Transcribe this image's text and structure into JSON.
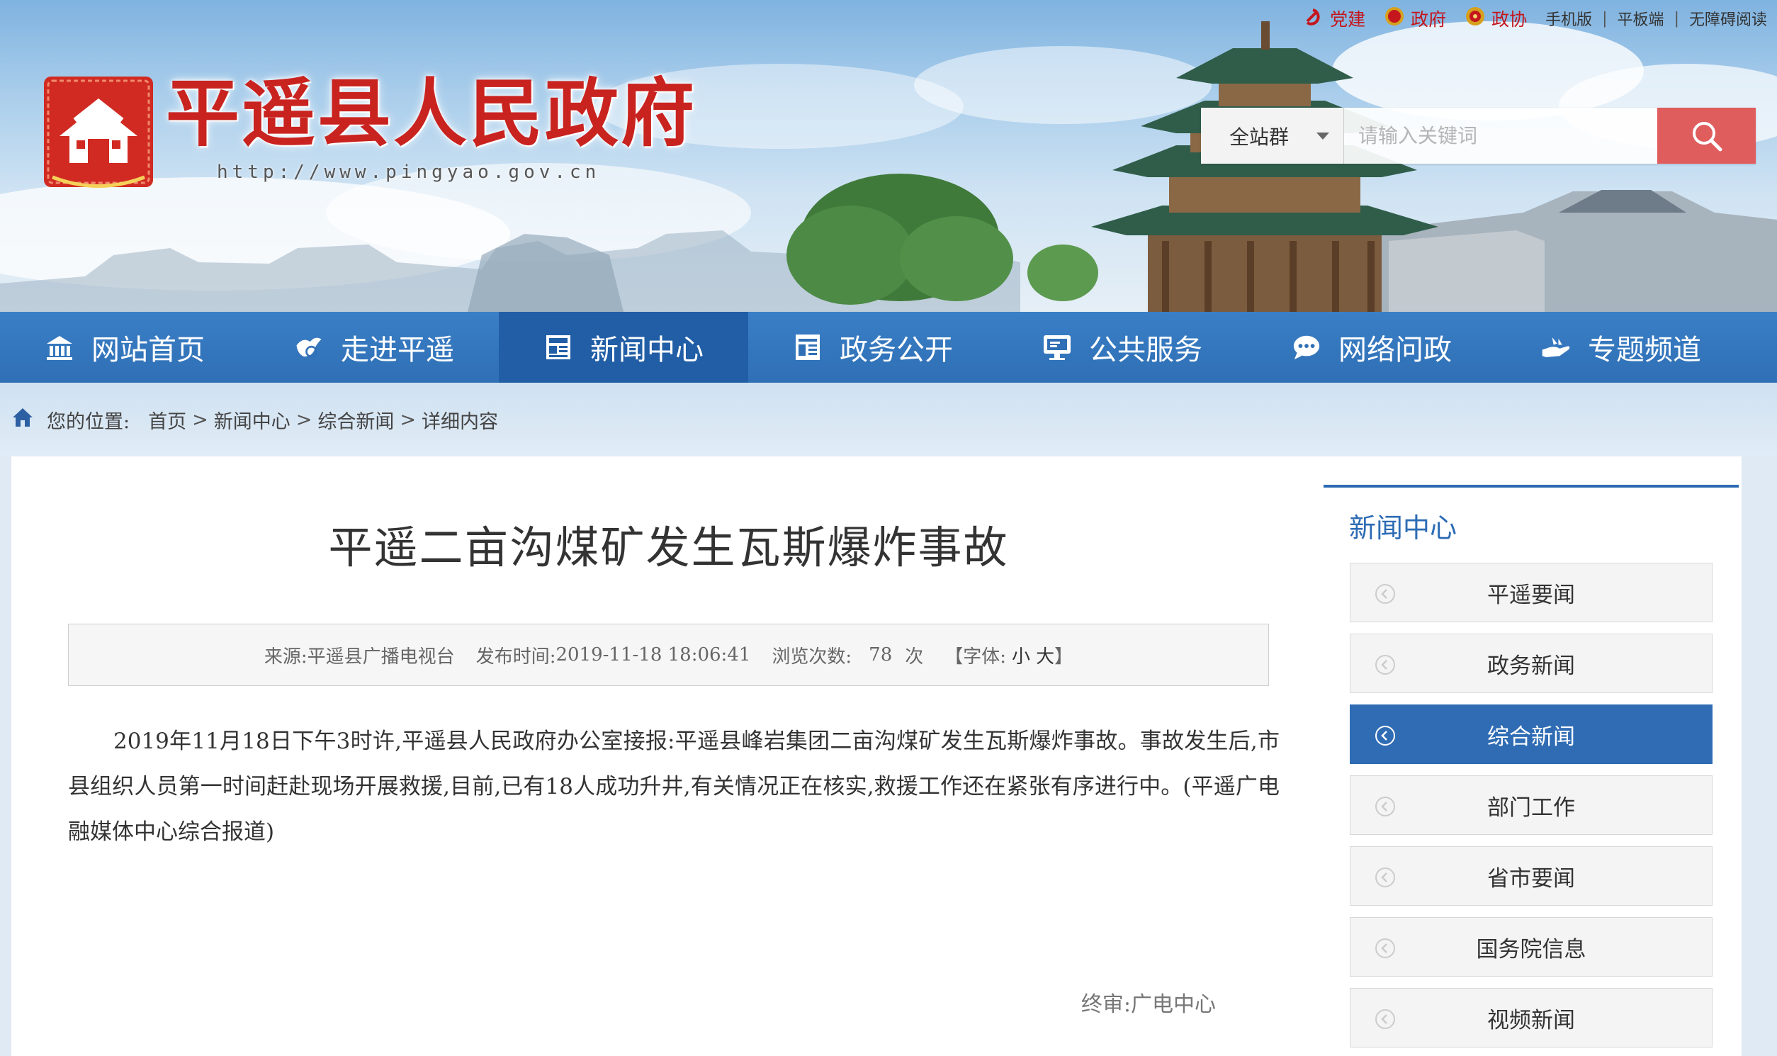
{
  "topbar": {
    "party_links": [
      "党建",
      "政府",
      "政协"
    ],
    "links": [
      "手机版",
      "平板端",
      "无障碍阅读"
    ],
    "separator": "|"
  },
  "header": {
    "site_title": "平遥县人民政府",
    "site_url": "http://www.pingyao.gov.cn"
  },
  "search": {
    "scope_label": "全站群",
    "placeholder": "请输入关键词"
  },
  "nav": {
    "items": [
      {
        "label": "网站首页",
        "icon": "bank-icon"
      },
      {
        "label": "走进平遥",
        "icon": "bird-icon"
      },
      {
        "label": "新闻中心",
        "icon": "newspaper-icon"
      },
      {
        "label": "政务公开",
        "icon": "document-icon"
      },
      {
        "label": "公共服务",
        "icon": "monitor-icon"
      },
      {
        "label": "网络问政",
        "icon": "chat-icon"
      },
      {
        "label": "专题频道",
        "icon": "hand-icon"
      }
    ],
    "active_index": 2
  },
  "breadcrumb": {
    "label": "您的位置:",
    "items": [
      "首页",
      "新闻中心",
      "综合新闻",
      "详细内容"
    ],
    "separator": ">"
  },
  "article": {
    "title": "平遥二亩沟煤矿发生瓦斯爆炸事故",
    "meta": {
      "source_label": "来源:",
      "source": "平遥县广播电视台",
      "time_label": "发布时间:",
      "time": "2019-11-18 18:06:41",
      "views_label": "浏览次数:",
      "views": "78",
      "views_unit": "次",
      "font_open": "【字体:",
      "font_small": "小",
      "font_large": "大",
      "font_close": "】"
    },
    "body": "2019年11月18日下午3时许,平遥县人民政府办公室接报:平遥县峰岩集团二亩沟煤矿发生瓦斯爆炸事故。事故发生后,市县组织人员第一时间赶赴现场开展救援,目前,已有18人成功升井,有关情况正在核实,救援工作还在紧张有序进行中。(平遥广电融媒体中心综合报道)",
    "reviewer": "终审:广电中心"
  },
  "sidebar": {
    "title": "新闻中心",
    "items": [
      "平遥要闻",
      "政务新闻",
      "综合新闻",
      "部门工作",
      "省市要闻",
      "国务院信息",
      "视频新闻"
    ],
    "active_index": 2
  },
  "colors": {
    "brand_red": "#c92320",
    "nav_blue": "#2f6fb5",
    "nav_active": "#215ea6",
    "sidebar_active": "#2f6cb4",
    "search_button": "#e05d5e"
  }
}
